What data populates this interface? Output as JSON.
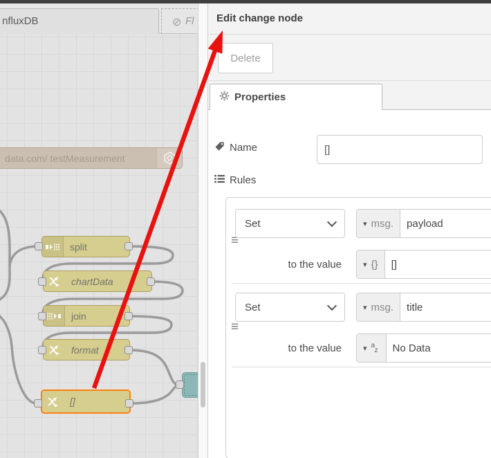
{
  "workspace": {
    "tabs": [
      {
        "label": "nfluxDB",
        "state": "active"
      },
      {
        "label": "Fl",
        "state": "disabled",
        "icon": "no-entry-icon"
      }
    ],
    "nodes": [
      {
        "label": "data.com/ testMeasurement",
        "type": "influxdb-out",
        "icon": "influxdb-icon"
      },
      {
        "label": "split",
        "type": "split",
        "icon": "split-icon"
      },
      {
        "label": "chartData",
        "type": "change",
        "icon": "change-icon"
      },
      {
        "label": "join",
        "type": "join",
        "icon": "join-icon"
      },
      {
        "label": "format",
        "type": "change",
        "icon": "change-icon"
      },
      {
        "label": "[]",
        "type": "change",
        "icon": "change-icon",
        "selected": true
      },
      {
        "label": "",
        "type": "dashboard-chart",
        "partially_hidden": true
      }
    ]
  },
  "panel": {
    "title": "Edit change node",
    "toolbar": {
      "delete_label": "Delete"
    },
    "tabs": [
      {
        "label": "Properties",
        "icon": "gear-icon"
      }
    ],
    "form": {
      "name_label": "Name",
      "name_value": "[]",
      "rules_label": "Rules"
    },
    "rules": [
      {
        "action": "Set",
        "property_prefix": "msg.",
        "property": "payload",
        "to_label": "to the value",
        "value_type_label": "{}",
        "value": "[]"
      },
      {
        "action": "Set",
        "property_prefix": "msg.",
        "property": "title",
        "to_label": "to the value",
        "value_type_a": "a",
        "value_type_z": "z",
        "value": "No Data"
      }
    ]
  },
  "icons": {
    "caret": "▾",
    "no_entry": "⊘",
    "drag": "≡"
  },
  "colors": {
    "node_yellow": "#d6ce8f",
    "node_tan": "#cbbfb1",
    "node_teal": "#8cb7b7",
    "selected_border": "#ff7f0e",
    "wire": "#9b9b9b",
    "arrow_red": "#e81210",
    "tray_gray": "#f3f3f3"
  }
}
